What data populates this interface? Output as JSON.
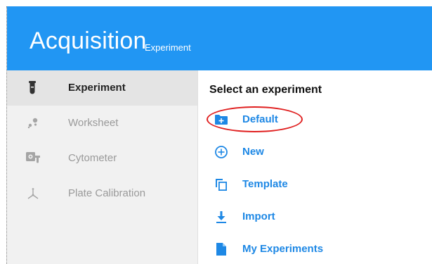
{
  "header": {
    "title": "Acquisition",
    "subtitle": "Experiment",
    "color": "#2196f3"
  },
  "sidebar": {
    "items": [
      {
        "label": "Experiment",
        "icon": "test-tube-icon",
        "active": true
      },
      {
        "label": "Worksheet",
        "icon": "dots-cluster-icon",
        "active": false
      },
      {
        "label": "Cytometer",
        "icon": "cytometer-icon",
        "active": false
      },
      {
        "label": "Plate Calibration",
        "icon": "axes-calibration-icon",
        "active": false
      }
    ]
  },
  "main": {
    "heading": "Select an experiment",
    "options": [
      {
        "label": "Default",
        "icon": "folder-plus-icon"
      },
      {
        "label": "New",
        "icon": "circle-plus-icon"
      },
      {
        "label": "Template",
        "icon": "copy-icon"
      },
      {
        "label": "Import",
        "icon": "download-icon"
      },
      {
        "label": "My Experiments",
        "icon": "file-icon"
      }
    ],
    "accent": "#1e88e5"
  },
  "annotation": {
    "target": "Default",
    "color": "#e02020"
  }
}
